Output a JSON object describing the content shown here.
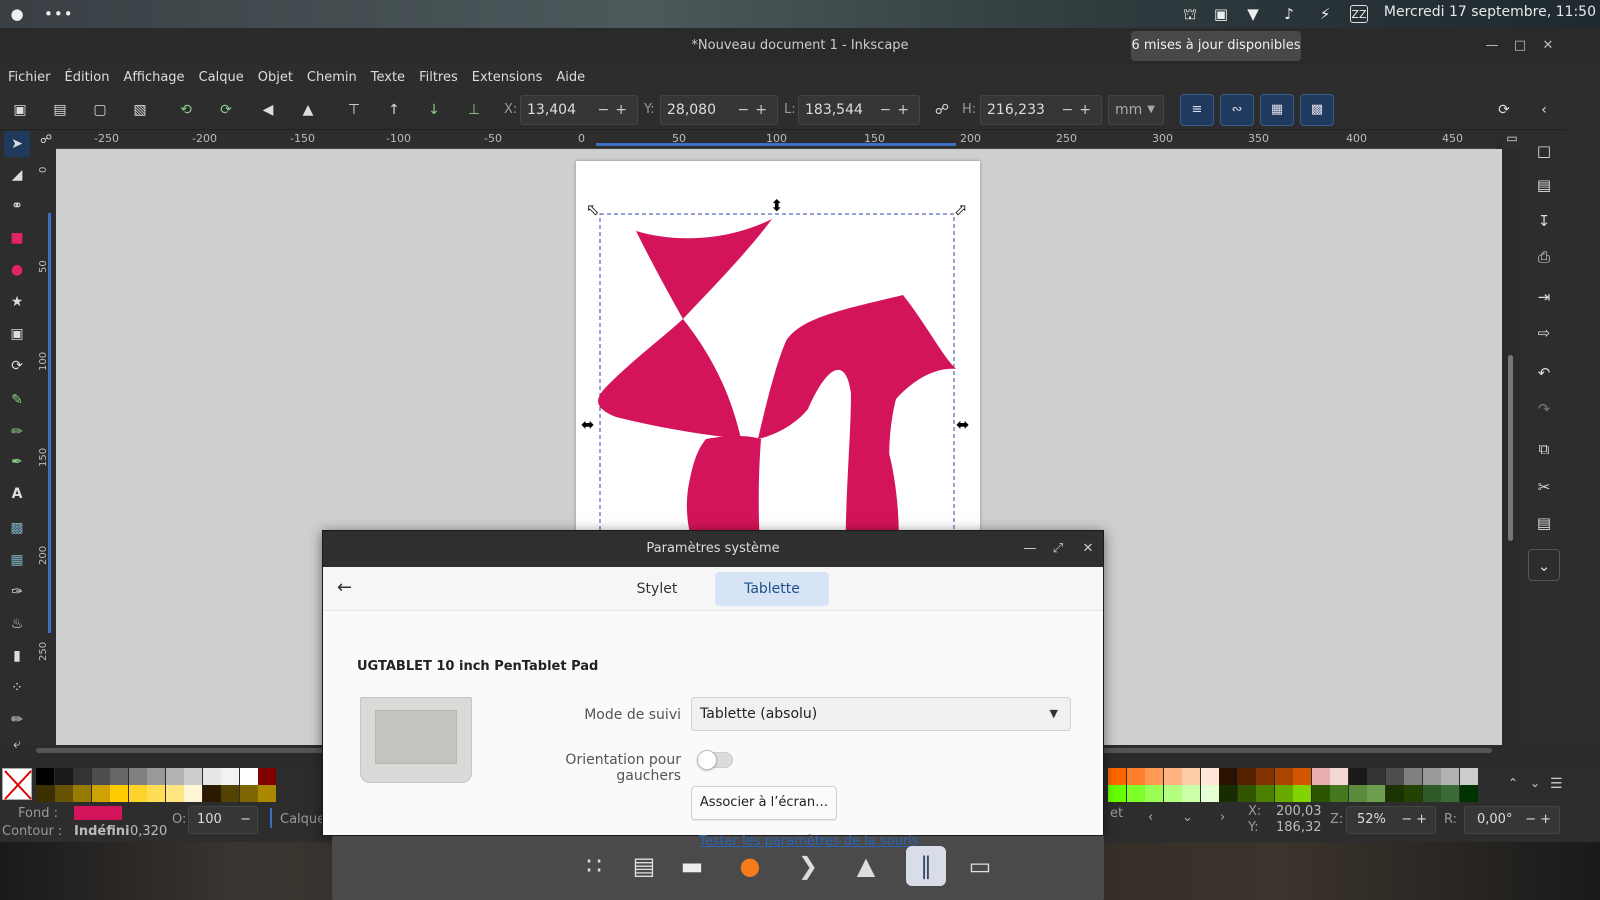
{
  "system_bar": {
    "clock": "Mercredi 17 septembre, 11:50",
    "update_tooltip": "6 mises à jour disponibles"
  },
  "window": {
    "title": "*Nouveau document 1 - Inkscape"
  },
  "menu": [
    "Fichier",
    "Édition",
    "Affichage",
    "Calque",
    "Objet",
    "Chemin",
    "Texte",
    "Filtres",
    "Extensions",
    "Aide"
  ],
  "toolbar": {
    "x_label": "X:",
    "x_value": "13,404",
    "y_label": "Y:",
    "y_value": "28,080",
    "w_label": "L:",
    "w_value": "183,544",
    "h_label": "H:",
    "h_value": "216,233",
    "unit": "mm"
  },
  "ruler": {
    "h_labels": [
      "-250",
      "-200",
      "-150",
      "-100",
      "-50",
      "0",
      "50",
      "100",
      "150",
      "200",
      "250",
      "300",
      "350",
      "400",
      "450"
    ],
    "v_labels": [
      "0",
      "50",
      "100",
      "150",
      "200",
      "250"
    ]
  },
  "fill_color": "#d4145a",
  "status": {
    "fill_label": "Fond :",
    "stroke_label": "Contour :",
    "stroke_value": "Indéfini",
    "stroke_width": "0,320",
    "opacity_label": "O:",
    "opacity_value": "100",
    "layer_label": "Calque",
    "layer_tail": "et",
    "cursor_x_label": "X:",
    "cursor_x": "200,03",
    "cursor_y_label": "Y:",
    "cursor_y": "186,32",
    "zoom_label": "Z:",
    "zoom": "52%",
    "rotation_label": "R:",
    "rotation": "0,00°"
  },
  "dialog": {
    "title": "Paramètres système",
    "tabs": [
      {
        "label": "Stylet",
        "active": false
      },
      {
        "label": "Tablette",
        "active": true
      }
    ],
    "device_name": "UGTABLET 10 inch PenTablet Pad",
    "tracking_label": "Mode de suivi",
    "tracking_value": "Tablette (absolu)",
    "left_handed_label": "Orientation pour gauchers",
    "left_handed_on": false,
    "map_button": "Associer à l’écran…",
    "mouse_link": "Tester les paramètres de la souris"
  }
}
